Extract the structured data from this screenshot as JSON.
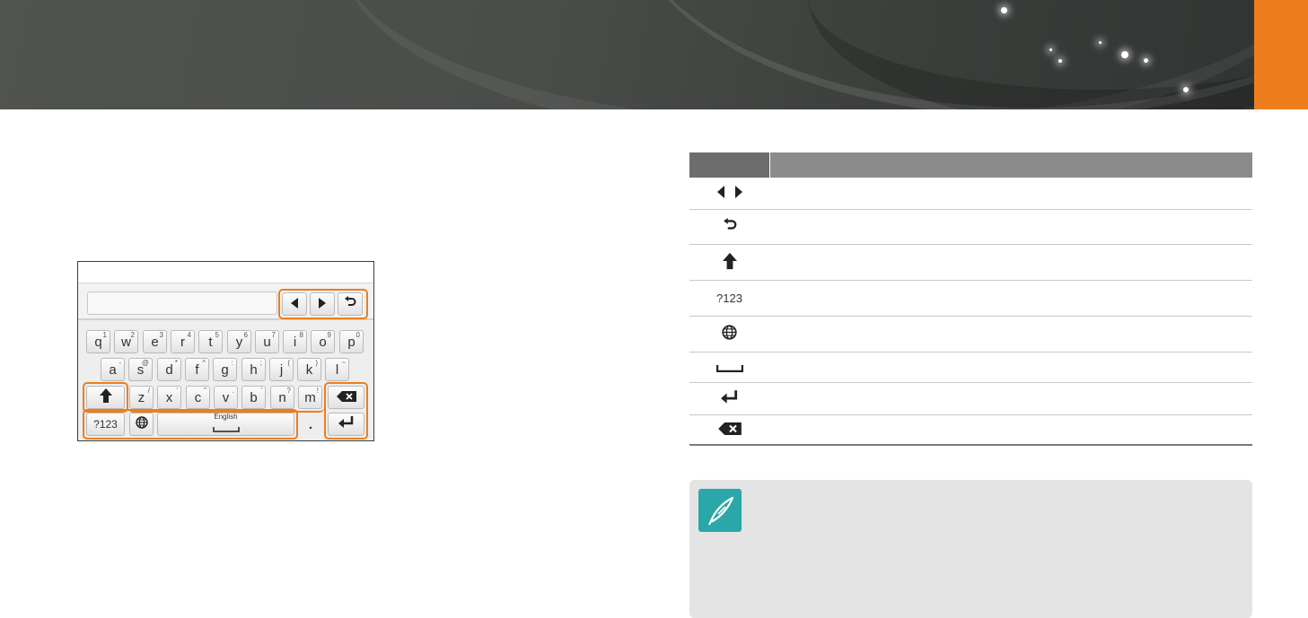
{
  "keyboard": {
    "rows": [
      {
        "keys": [
          {
            "main": "q",
            "sup": "1"
          },
          {
            "main": "w",
            "sup": "2"
          },
          {
            "main": "e",
            "sup": "3"
          },
          {
            "main": "r",
            "sup": "4"
          },
          {
            "main": "t",
            "sup": "5"
          },
          {
            "main": "y",
            "sup": "6"
          },
          {
            "main": "u",
            "sup": "7"
          },
          {
            "main": "i",
            "sup": "8"
          },
          {
            "main": "o",
            "sup": "9"
          },
          {
            "main": "p",
            "sup": "0"
          }
        ]
      },
      {
        "keys": [
          {
            "main": "a",
            "sup": "-"
          },
          {
            "main": "s",
            "sup": "@"
          },
          {
            "main": "d",
            "sup": "*"
          },
          {
            "main": "f",
            "sup": "^"
          },
          {
            "main": "g",
            "sup": ":"
          },
          {
            "main": "h",
            "sup": ";"
          },
          {
            "main": "j",
            "sup": "("
          },
          {
            "main": "k",
            "sup": ")"
          },
          {
            "main": "l",
            "sup": "~"
          }
        ]
      },
      {
        "keys": [
          {
            "main": "z",
            "sup": "/"
          },
          {
            "main": "x",
            "sup": "'"
          },
          {
            "main": "c",
            "sup": "\""
          },
          {
            "main": "v",
            "sup": "."
          },
          {
            "main": "b",
            "sup": "'"
          },
          {
            "main": "n",
            "sup": "?"
          },
          {
            "main": "m",
            "sup": "!"
          }
        ]
      }
    ],
    "num_key": "?123",
    "space_label": "English",
    "period_key": "."
  },
  "table": {
    "num_icon_text": "?123"
  },
  "colors": {
    "accent": "#ee7d1d",
    "note_icon": "#2aa7a9",
    "table_header_dark": "#6d6d6d",
    "table_header_light": "#8b8b8b"
  }
}
